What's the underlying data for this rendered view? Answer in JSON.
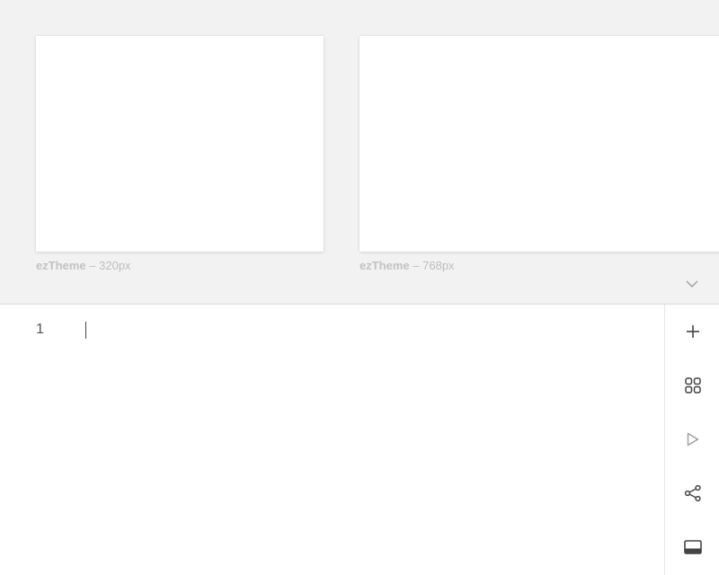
{
  "previews": [
    {
      "theme": "ezTheme",
      "separator": "–",
      "width_label": "320px"
    },
    {
      "theme": "ezTheme",
      "separator": "–",
      "width_label": "768px"
    }
  ],
  "editor": {
    "line_numbers": [
      "1"
    ]
  },
  "icons": {
    "collapse": "chevron-down-icon",
    "add": "plus-icon",
    "grid": "grid-icon",
    "run": "play-icon",
    "share": "share-icon",
    "panel": "panel-bottom-icon"
  },
  "colors": {
    "preview_background": "#f2f2f2",
    "icon": "#444444",
    "icon_muted": "#9e9e9e",
    "caption": "#bdbdbd"
  }
}
